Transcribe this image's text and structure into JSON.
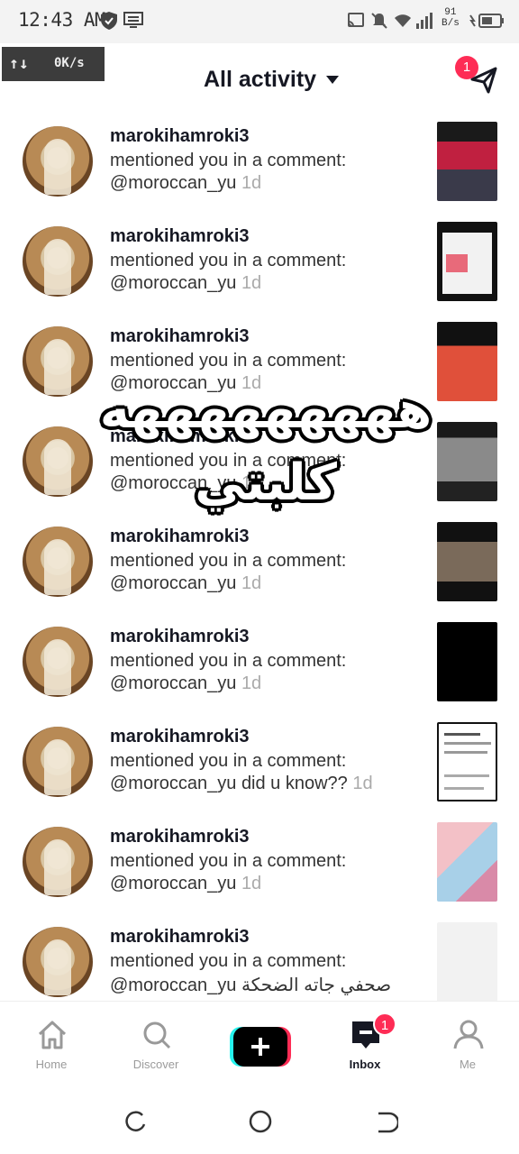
{
  "status_bar": {
    "time": "12:43 AM",
    "net_speed_value": "91",
    "net_speed_unit": "B/s",
    "icons": [
      "shield-icon",
      "monitor-icon",
      "cast-icon",
      "mute-icon",
      "wifi-icon",
      "signal-icon",
      "battery-icon"
    ]
  },
  "speed_overlay": {
    "arrows": "↑↓",
    "value": "0K/s"
  },
  "header": {
    "title": "All activity",
    "send_badge": "1"
  },
  "activities": [
    {
      "username": "marokihamroki3",
      "action": "mentioned you in a comment:",
      "mention": "@moroccan_yu",
      "extra": "",
      "age": "1d",
      "thumb": "thumb-1"
    },
    {
      "username": "marokihamroki3",
      "action": "mentioned you in a comment:",
      "mention": "@moroccan_yu",
      "extra": "",
      "age": "1d",
      "thumb": "thumb-2"
    },
    {
      "username": "marokihamroki3",
      "action": "mentioned you in a comment:",
      "mention": "@moroccan_yu",
      "extra": "",
      "age": "1d",
      "thumb": "thumb-3"
    },
    {
      "username": "marokihamroki3",
      "action": "mentioned you in a comment:",
      "mention": "@moroccan_yu",
      "extra": "",
      "age": "1d",
      "thumb": "thumb-4"
    },
    {
      "username": "marokihamroki3",
      "action": "mentioned you in a comment:",
      "mention": "@moroccan_yu",
      "extra": "",
      "age": "1d",
      "thumb": "thumb-5"
    },
    {
      "username": "marokihamroki3",
      "action": "mentioned you in a comment:",
      "mention": "@moroccan_yu",
      "extra": "",
      "age": "1d",
      "thumb": "thumb-6"
    },
    {
      "username": "marokihamroki3",
      "action": "mentioned you in a comment:",
      "mention": "@moroccan_yu",
      "extra": "did u know??",
      "age": "1d",
      "thumb": "thumb-7"
    },
    {
      "username": "marokihamroki3",
      "action": "mentioned you in a comment:",
      "mention": "@moroccan_yu",
      "extra": "",
      "age": "1d",
      "thumb": "thumb-8"
    },
    {
      "username": "marokihamroki3",
      "action": "mentioned you in a comment:",
      "mention": "@moroccan_yu",
      "extra": "صحفي جاته الضحكة",
      "age": "",
      "thumb": "thumb-9"
    }
  ],
  "overlay_caption": "هههههههههه كلبتي",
  "bottom_nav": {
    "home": "Home",
    "discover": "Discover",
    "inbox": "Inbox",
    "inbox_badge": "1",
    "me": "Me"
  },
  "colors": {
    "accent": "#fe2c55",
    "cyan": "#25f4ee",
    "text": "#161823"
  }
}
